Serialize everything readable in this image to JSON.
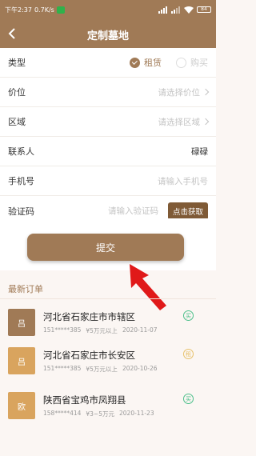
{
  "status": {
    "time": "下午2:37",
    "speed": "0.7K/s",
    "battery": "84"
  },
  "nav": {
    "title": "定制墓地"
  },
  "form": {
    "type_label": "类型",
    "type_option_rent": "租赁",
    "type_option_buy": "购买",
    "price_label": "价位",
    "price_placeholder": "请选择价位",
    "area_label": "区域",
    "area_placeholder": "请选择区域",
    "contact_label": "联系人",
    "contact_value": "碌碌",
    "phone_label": "手机号",
    "phone_placeholder": "请输入手机号",
    "code_label": "验证码",
    "code_placeholder": "请输入验证码",
    "get_code": "点击获取"
  },
  "submit_label": "提交",
  "orders": {
    "title": "最新订单",
    "items": [
      {
        "avatar": "吕",
        "avatar_color": "#a07a56",
        "name": "河北省石家庄市市辖区",
        "phone": "151*****385",
        "price": "¥5万元以上",
        "date": "2020-11-07",
        "badge": "买",
        "badge_type": "green"
      },
      {
        "avatar": "吕",
        "avatar_color": "#d9a45e",
        "name": "河北省石家庄市长安区",
        "phone": "151*****385",
        "price": "¥5万元以上",
        "date": "2020-10-26",
        "badge": "租",
        "badge_type": "yellow"
      },
      {
        "avatar": "欧",
        "avatar_color": "#d9a45e",
        "name": "陕西省宝鸡市凤翔县",
        "phone": "158*****414",
        "price": "¥3~5万元",
        "date": "2020-11-23",
        "badge": "买",
        "badge_type": "green"
      }
    ]
  },
  "colors": {
    "brand": "#a07a56",
    "arrow": "#e01919"
  }
}
